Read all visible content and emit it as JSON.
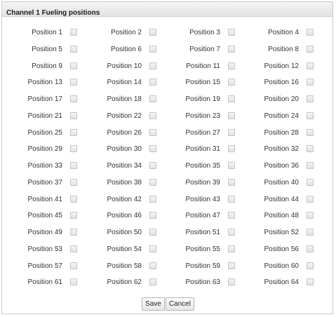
{
  "dialog": {
    "title": "Channel 1 Fueling positions"
  },
  "positions": [
    {
      "label": "Position 1",
      "checked": false
    },
    {
      "label": "Position 2",
      "checked": false
    },
    {
      "label": "Position 3",
      "checked": false
    },
    {
      "label": "Position 4",
      "checked": false
    },
    {
      "label": "Position 5",
      "checked": false
    },
    {
      "label": "Position 6",
      "checked": false
    },
    {
      "label": "Position 7",
      "checked": false
    },
    {
      "label": "Position 8",
      "checked": false
    },
    {
      "label": "Position 9",
      "checked": false
    },
    {
      "label": "Position 10",
      "checked": false
    },
    {
      "label": "Position 11",
      "checked": false
    },
    {
      "label": "Position 12",
      "checked": false
    },
    {
      "label": "Position 13",
      "checked": false
    },
    {
      "label": "Position 14",
      "checked": false
    },
    {
      "label": "Position 15",
      "checked": false
    },
    {
      "label": "Position 16",
      "checked": false
    },
    {
      "label": "Position 17",
      "checked": false
    },
    {
      "label": "Position 18",
      "checked": false
    },
    {
      "label": "Position 19",
      "checked": false
    },
    {
      "label": "Position 20",
      "checked": false
    },
    {
      "label": "Position 21",
      "checked": false
    },
    {
      "label": "Position 22",
      "checked": false
    },
    {
      "label": "Position 23",
      "checked": false
    },
    {
      "label": "Position 24",
      "checked": false
    },
    {
      "label": "Position 25",
      "checked": false
    },
    {
      "label": "Position 26",
      "checked": false
    },
    {
      "label": "Position 27",
      "checked": false
    },
    {
      "label": "Position 28",
      "checked": false
    },
    {
      "label": "Position 29",
      "checked": false
    },
    {
      "label": "Position 30",
      "checked": false
    },
    {
      "label": "Position 31",
      "checked": false
    },
    {
      "label": "Position 32",
      "checked": false
    },
    {
      "label": "Position 33",
      "checked": false
    },
    {
      "label": "Position 34",
      "checked": false
    },
    {
      "label": "Position 35",
      "checked": false
    },
    {
      "label": "Position 36",
      "checked": false
    },
    {
      "label": "Position 37",
      "checked": false
    },
    {
      "label": "Position 38",
      "checked": false
    },
    {
      "label": "Position 39",
      "checked": false
    },
    {
      "label": "Position 40",
      "checked": false
    },
    {
      "label": "Position 41",
      "checked": false
    },
    {
      "label": "Position 42",
      "checked": false
    },
    {
      "label": "Position 43",
      "checked": false
    },
    {
      "label": "Position 44",
      "checked": false
    },
    {
      "label": "Position 45",
      "checked": false
    },
    {
      "label": "Position 46",
      "checked": false
    },
    {
      "label": "Position 47",
      "checked": false
    },
    {
      "label": "Position 48",
      "checked": false
    },
    {
      "label": "Position 49",
      "checked": false
    },
    {
      "label": "Position 50",
      "checked": false
    },
    {
      "label": "Position 51",
      "checked": false
    },
    {
      "label": "Position 52",
      "checked": false
    },
    {
      "label": "Position 53",
      "checked": false
    },
    {
      "label": "Position 54",
      "checked": false
    },
    {
      "label": "Position 55",
      "checked": false
    },
    {
      "label": "Position 56",
      "checked": false
    },
    {
      "label": "Position 57",
      "checked": false
    },
    {
      "label": "Position 58",
      "checked": false
    },
    {
      "label": "Position 59",
      "checked": false
    },
    {
      "label": "Position 60",
      "checked": false
    },
    {
      "label": "Position 61",
      "checked": false
    },
    {
      "label": "Position 62",
      "checked": false
    },
    {
      "label": "Position 63",
      "checked": false
    },
    {
      "label": "Position 64",
      "checked": false
    }
  ],
  "buttons": {
    "save_label": "Save",
    "cancel_label": "Cancel"
  }
}
